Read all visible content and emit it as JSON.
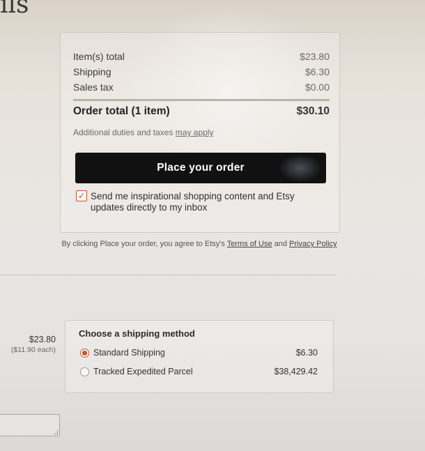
{
  "heading_fragment": "ils",
  "summary": {
    "items_total_label": "Item(s) total",
    "items_total_value": "$23.80",
    "shipping_label": "Shipping",
    "shipping_value": "$6.30",
    "sales_tax_label": "Sales tax",
    "sales_tax_value": "$0.00",
    "order_total_label": "Order total (1 item)",
    "order_total_value": "$30.10",
    "duties_text": "Additional duties and taxes",
    "duties_link": "may apply"
  },
  "place_order_label": "Place your order",
  "optin": {
    "checked": true,
    "text": "Send me inspirational shopping content and Etsy updates directly to my inbox"
  },
  "terms": {
    "prefix": "By clicking Place your order, you agree to Etsy's",
    "terms_link": "Terms of Use",
    "and": "and",
    "privacy_link": "Privacy Policy"
  },
  "item_price": {
    "amount": "$23.80",
    "each": "($11.90 each)"
  },
  "shipping": {
    "title": "Choose a shipping method",
    "options": [
      {
        "label": "Standard Shipping",
        "price": "$6.30",
        "selected": true
      },
      {
        "label": "Tracked Expedited Parcel",
        "price": "$38,429.42",
        "selected": false
      }
    ]
  },
  "colors": {
    "accent": "#c0562b",
    "button": "#111111"
  }
}
